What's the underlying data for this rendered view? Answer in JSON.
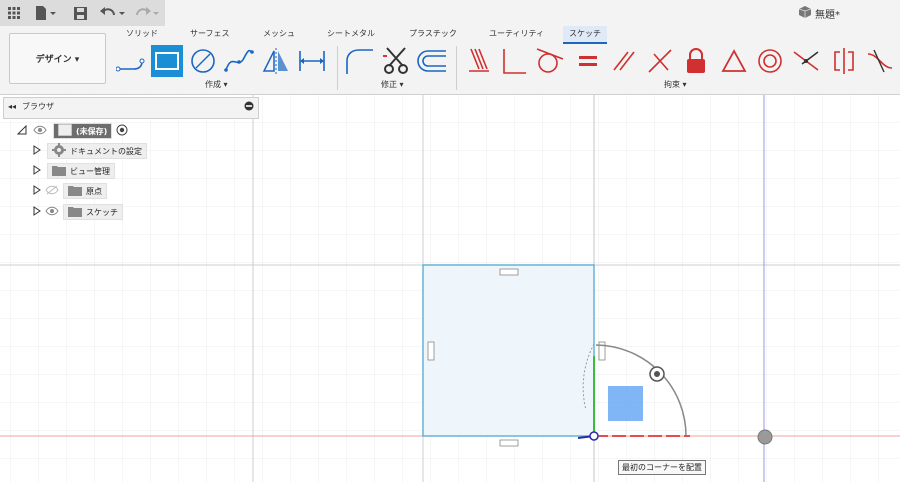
{
  "app": {
    "document_title": "無題*"
  },
  "ribbon": {
    "tabs": [
      {
        "label": "ソリッド"
      },
      {
        "label": "サーフェス"
      },
      {
        "label": "メッシュ"
      },
      {
        "label": "シートメタル"
      },
      {
        "label": "プラスチック"
      },
      {
        "label": "ユーティリティ"
      },
      {
        "label": "スケッチ"
      }
    ],
    "active_tab": "スケッチ",
    "workspace": "デザイン ▾",
    "groups": {
      "create": "作成 ▾",
      "modify": "修正 ▾",
      "constraints": "拘束 ▾"
    }
  },
  "browser": {
    "title": "ブラウザ",
    "root_label": "(未保存)",
    "items": [
      {
        "label": "ドキュメントの設定"
      },
      {
        "label": "ビュー管理"
      },
      {
        "label": "原点"
      },
      {
        "label": "スケッチ"
      }
    ]
  },
  "tooltip": {
    "text": "最初のコーナーを配置"
  },
  "colors": {
    "accent": "#1a8fd6",
    "red_axis": "#e05050",
    "green_axis": "#3dbb3d",
    "blue_axis": "#6d6dd6",
    "rect_fill": "#eef6fc",
    "rect_stroke": "#5aaed6"
  }
}
